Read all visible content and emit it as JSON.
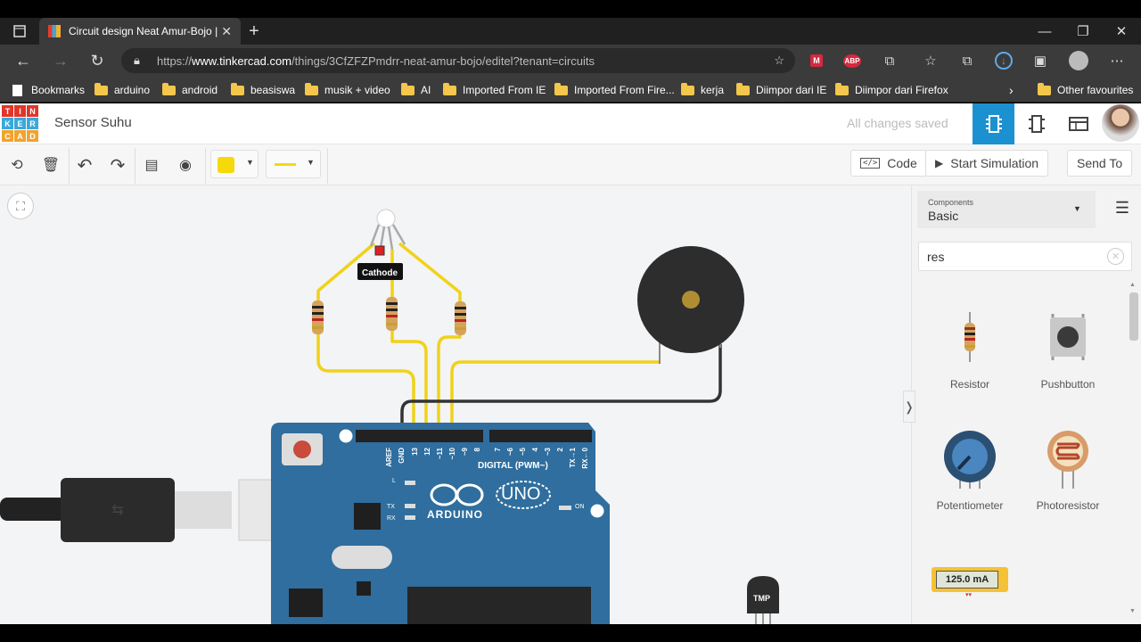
{
  "browser": {
    "tab_title": "Circuit design Neat Amur-Bojo |",
    "url_prefix": "https://",
    "url_domain": "www.tinkercad.com",
    "url_path": "/things/3CfZFZPmdrr-neat-amur-bojo/editel?tenant=circuits",
    "bookmarks": [
      "Bookmarks",
      "arduino",
      "android",
      "beasiswa",
      "musik + video",
      "AI",
      "Imported From IE",
      "Imported From Fire...",
      "kerja",
      "Diimpor dari IE",
      "Diimpor dari Firefox"
    ],
    "other_favourites": "Other favourites"
  },
  "app": {
    "logo_letters": [
      "TIN",
      "KER",
      "CAD"
    ],
    "title": "Sensor Suhu",
    "save_status": "All changes saved"
  },
  "toolbar": {
    "code_label": "Code",
    "simulate_label": "Start Simulation",
    "send_label": "Send To",
    "color_swatch": "#f5d90a"
  },
  "canvas": {
    "tooltip": "Cathode",
    "arduino_brand": "ARDUINO",
    "arduino_model": "UNO",
    "digital_label": "DIGITAL (PWM~)",
    "pin_labels": [
      "AREF",
      "GND",
      "13",
      "12",
      "~11",
      "~10",
      "~9",
      "8",
      "7",
      "~6",
      "~5",
      "4",
      "~3",
      "2",
      "TX→1",
      "RX←0"
    ],
    "led_labels": [
      "L",
      "TX",
      "RX"
    ],
    "on_label": "ON",
    "tmp_label": "TMP"
  },
  "panel": {
    "components_caption": "Components",
    "components_value": "Basic",
    "search_value": "res",
    "components": [
      {
        "label": "Resistor",
        "icon": "resistor-icon"
      },
      {
        "label": "Pushbutton",
        "icon": "pushbutton-icon"
      },
      {
        "label": "Potentiometer",
        "icon": "potentiometer-icon"
      },
      {
        "label": "Photoresistor",
        "icon": "photoresistor-icon"
      }
    ],
    "meter_value": "125.0 mA"
  }
}
